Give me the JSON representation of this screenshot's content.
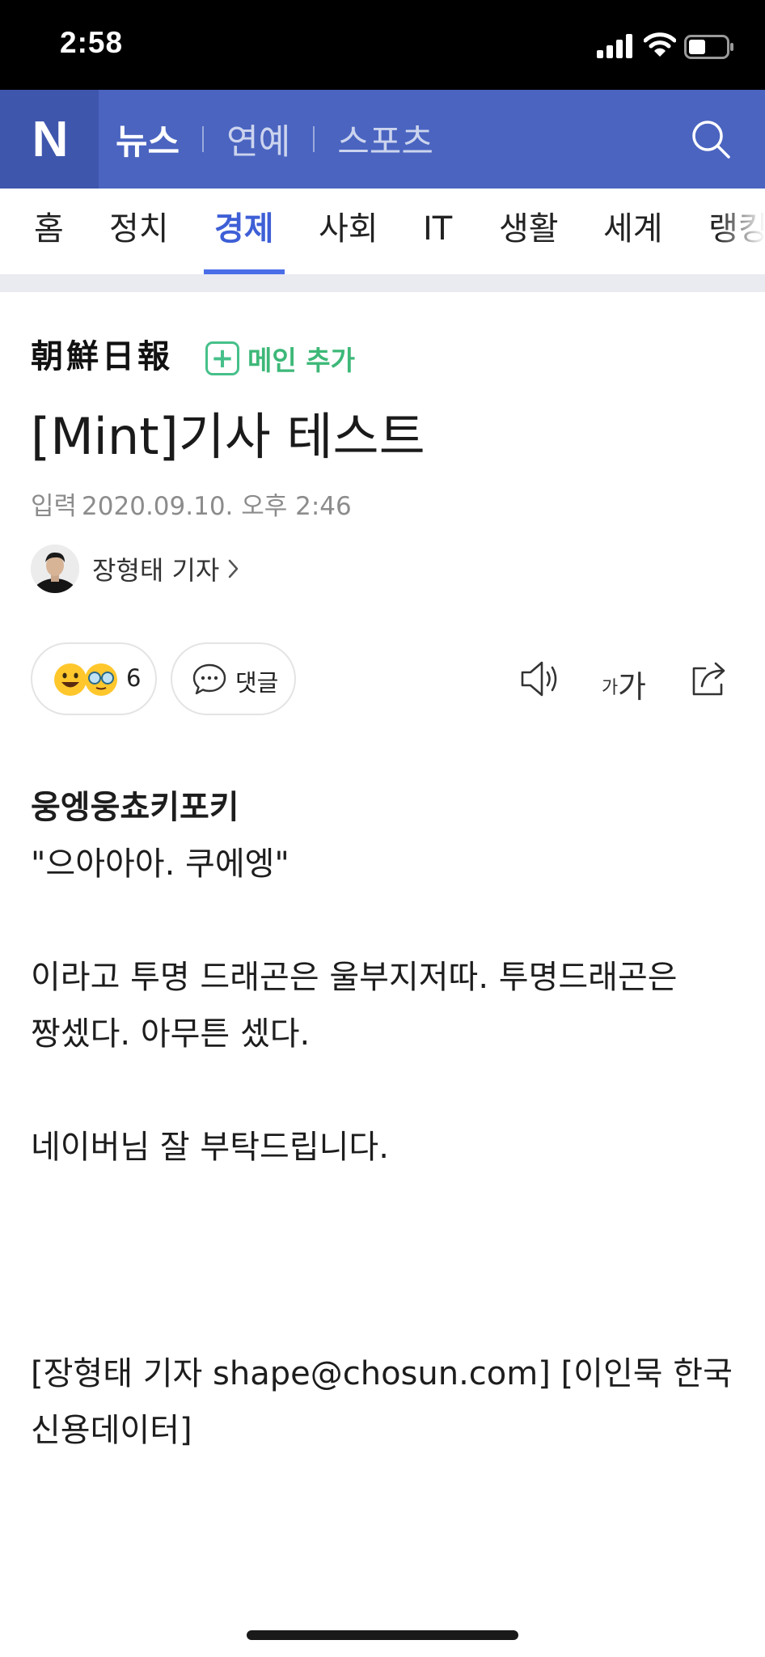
{
  "status_bar": {
    "time": "2:58",
    "battery_level": 0.45
  },
  "header": {
    "logo": "N",
    "tabs": [
      {
        "label": "뉴스",
        "active": true
      },
      {
        "label": "연예",
        "active": false
      },
      {
        "label": "스포츠",
        "active": false
      }
    ],
    "search_icon": "search-icon"
  },
  "categories": [
    "홈",
    "정치",
    "경제",
    "사회",
    "IT",
    "생활",
    "세계",
    "랭킹"
  ],
  "active_category": "경제",
  "article": {
    "press": "朝鮮日報",
    "add_main_label": "메인 추가",
    "title": "[Mint]기사 테스트",
    "date_label": "입력",
    "date": "2020.09.10. 오후 2:46",
    "reporter": "장형태 기자",
    "reaction_count": "6",
    "comment_label": "댓글",
    "font_size_small": "가",
    "font_size_big": "가",
    "body": {
      "subtitle": "웅엥웅쵸키포키",
      "quote": "\"으아아아. 쿠에엥\"",
      "para1_line1": "이라고 투명 드래곤은 울부지저따. 투명드래곤은",
      "para1_line2": "짱셌다. 아무튼 셌다.",
      "para2": "네이버님 잘 부탁드립니다.",
      "byline_line1": "[장형태 기자 shape@chosun.com] [이인묵 한국",
      "byline_line2": "신용데이터]"
    }
  },
  "colors": {
    "header_bg": "#4a64c0",
    "logo_bg": "#3f56ad",
    "active_category": "#3e5fd6",
    "add_main": "#46c08a"
  }
}
